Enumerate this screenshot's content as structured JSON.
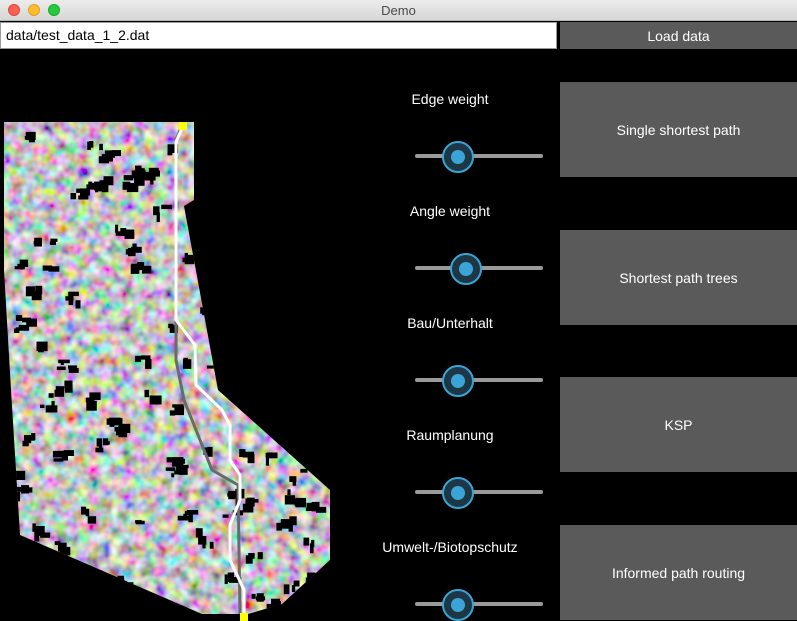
{
  "window": {
    "title": "Demo"
  },
  "file": {
    "path": "data/test_data_1_2.dat",
    "load_label": "Load data"
  },
  "sliders": [
    {
      "label": "Edge weight",
      "value": 0.33
    },
    {
      "label": "Angle weight",
      "value": 0.39
    },
    {
      "label": "Bau/Unterhalt",
      "value": 0.33
    },
    {
      "label": "Raumplanung",
      "value": 0.33
    },
    {
      "label": "Umwelt-/Biotopschutz",
      "value": 0.33
    }
  ],
  "actions": {
    "single": "Single shortest path",
    "trees": "Shortest path trees",
    "ksp": "KSP",
    "informed": "Informed path routing"
  },
  "colors": {
    "path": "#ffffff",
    "endpoint": "#ffff00",
    "button_bg": "#5a5a5a",
    "slider_accent": "#3ba4d6"
  }
}
